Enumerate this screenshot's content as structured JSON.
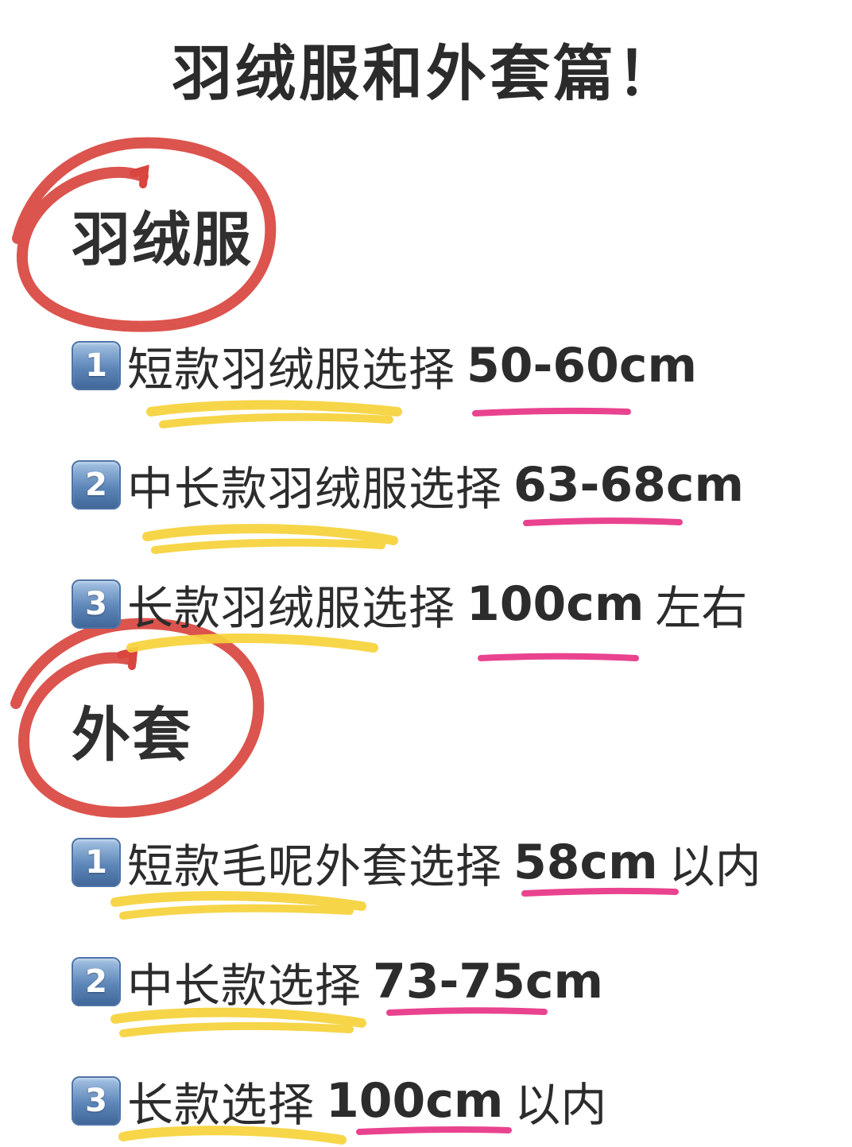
{
  "title": "羽绒服和外套篇！",
  "colors": {
    "circle": "#d9453f",
    "highlight_yellow": "#f6d23a",
    "highlight_pink": "#e9438f",
    "badge": "#5d86b9"
  },
  "sections": [
    {
      "heading": "羽绒服",
      "items": [
        {
          "num": "1",
          "text": "短款羽绒服选择",
          "size": "50-60cm",
          "suffix": ""
        },
        {
          "num": "2",
          "text": "中长款羽绒服选择",
          "size": "63-68cm",
          "suffix": ""
        },
        {
          "num": "3",
          "text": "长款羽绒服选择",
          "size": "100cm",
          "suffix": "左右"
        }
      ]
    },
    {
      "heading": "外套",
      "items": [
        {
          "num": "1",
          "text": "短款毛呢外套选择",
          "size": "58cm",
          "suffix": "以内"
        },
        {
          "num": "2",
          "text": "中长款选择",
          "size": "73-75cm",
          "suffix": ""
        },
        {
          "num": "3",
          "text": "长款选择",
          "size": "100cm",
          "suffix": "以内"
        }
      ]
    }
  ]
}
